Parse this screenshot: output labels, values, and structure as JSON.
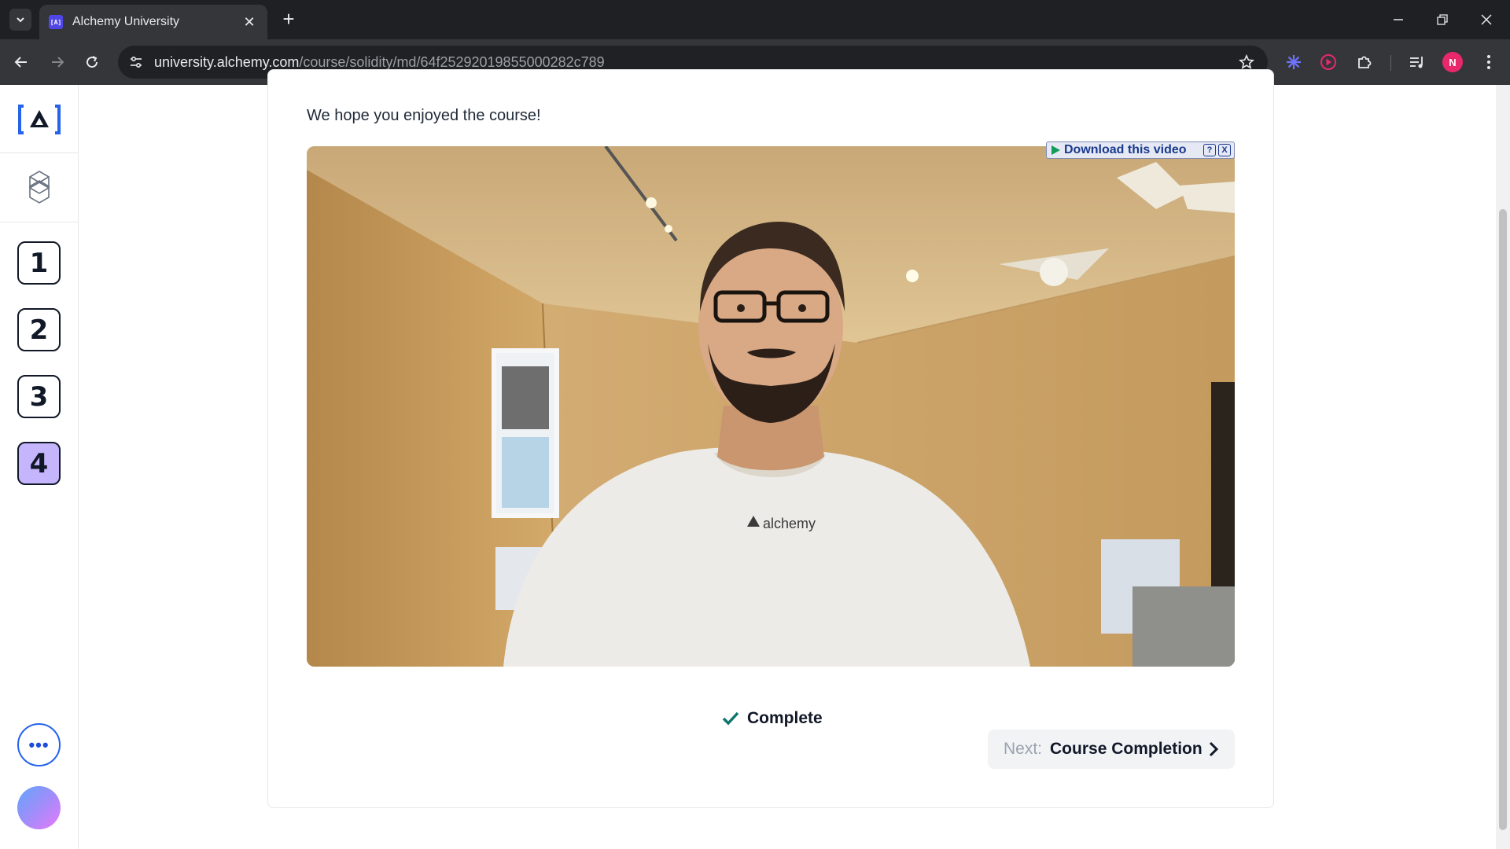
{
  "browser": {
    "tab_title": "Alchemy University",
    "favicon_text": "[A]",
    "url_host": "university.alchemy.com",
    "url_path": "/course/solidity/md/64f25292019855000282c789",
    "profile_initial": "N"
  },
  "sidebar": {
    "steps": [
      "1",
      "2",
      "3",
      "4"
    ],
    "active_step": "4",
    "more_label": "•••"
  },
  "content": {
    "intro_text": "We hope you enjoyed the course!",
    "download_label": "Download this video",
    "download_help": "?",
    "download_close": "X",
    "shirt_text": "alchemy",
    "complete_label": "Complete",
    "next_prefix": "Next:",
    "next_title": "Course Completion"
  },
  "colors": {
    "accent": "#2563eb",
    "active_step": "#c4b5fd",
    "complete_check": "#0f766e"
  }
}
